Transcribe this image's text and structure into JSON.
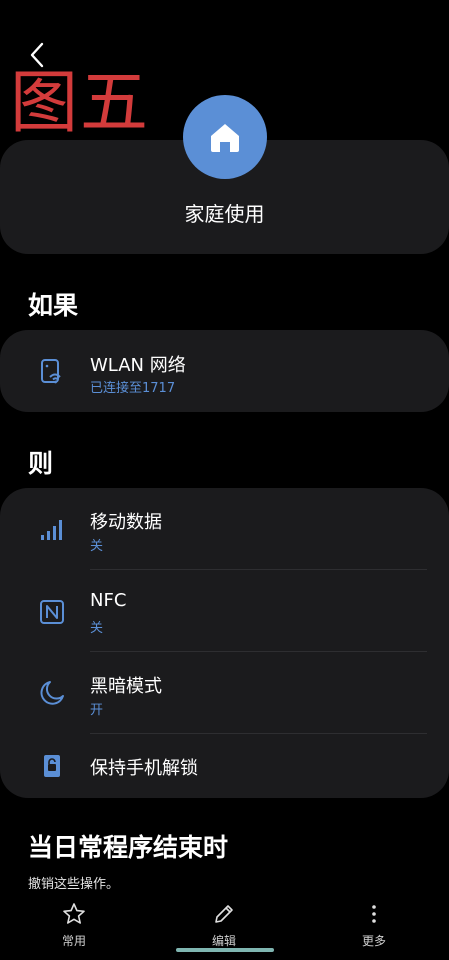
{
  "annotation": "图五",
  "routine": {
    "name": "家庭使用",
    "icon": "home-icon",
    "accent": "#5b8fd6"
  },
  "if_section": {
    "title": "如果",
    "items": [
      {
        "title": "WLAN 网络",
        "subtitle": "已连接至1717",
        "icon": "wifi-phone-icon"
      }
    ]
  },
  "then_section": {
    "title": "则",
    "items": [
      {
        "title": "移动数据",
        "subtitle": "关",
        "icon": "signal-bars-icon"
      },
      {
        "title": "NFC",
        "subtitle": "关",
        "icon": "nfc-icon"
      },
      {
        "title": "黑暗模式",
        "subtitle": "开",
        "icon": "moon-icon"
      },
      {
        "title": "保持手机解锁",
        "subtitle": "",
        "icon": "lock-icon"
      }
    ]
  },
  "end_section": {
    "title": "当日常程序结束时",
    "description": "撤销这些操作。"
  },
  "bottom_nav": [
    {
      "label": "常用",
      "icon": "star-icon"
    },
    {
      "label": "编辑",
      "icon": "pencil-icon"
    },
    {
      "label": "更多",
      "icon": "more-vertical-icon"
    }
  ],
  "colors": {
    "background": "#000000",
    "card": "#1b1b1d",
    "accent": "#5b8fd6",
    "annotation": "#d33b3b"
  }
}
